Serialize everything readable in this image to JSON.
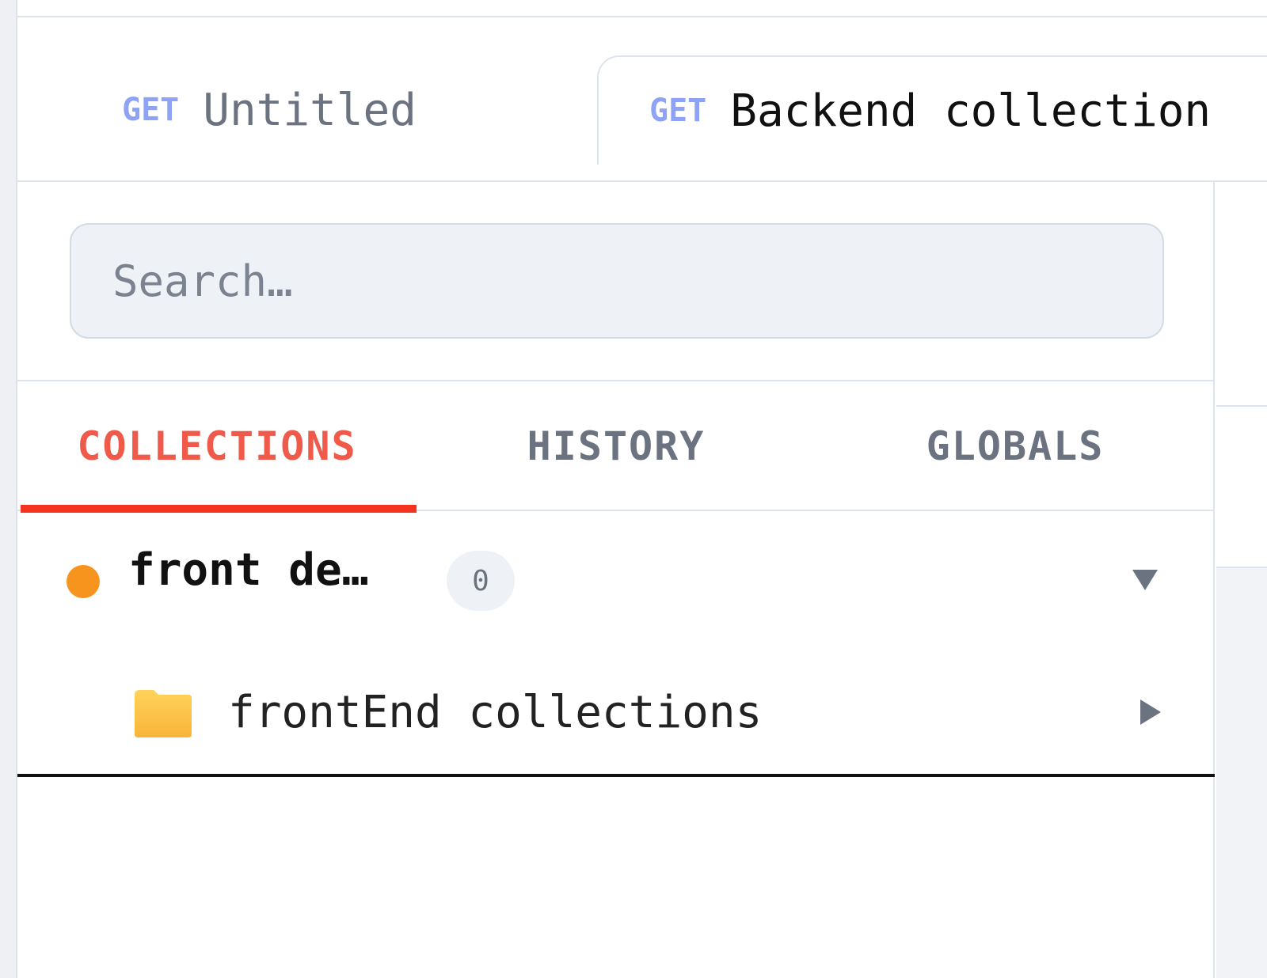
{
  "request_tabs": [
    {
      "method": "GET",
      "title": "Untitled"
    },
    {
      "method": "GET",
      "title": "Backend collection"
    }
  ],
  "search": {
    "placeholder": "Search…"
  },
  "sidebar_tabs": {
    "collections": "COLLECTIONS",
    "history": "HISTORY",
    "globals": "GLOBALS",
    "active": "COLLECTIONS"
  },
  "collection": {
    "name": "front de…",
    "count": "0",
    "status_color": "#f7941e",
    "expanded_icon": "caret-down-icon"
  },
  "folder": {
    "name": "frontEnd collections",
    "icon": "folder-icon",
    "expand_icon": "caret-right-icon"
  },
  "colors": {
    "accent": "#f5341f",
    "method_get": "#8ea3f5"
  }
}
